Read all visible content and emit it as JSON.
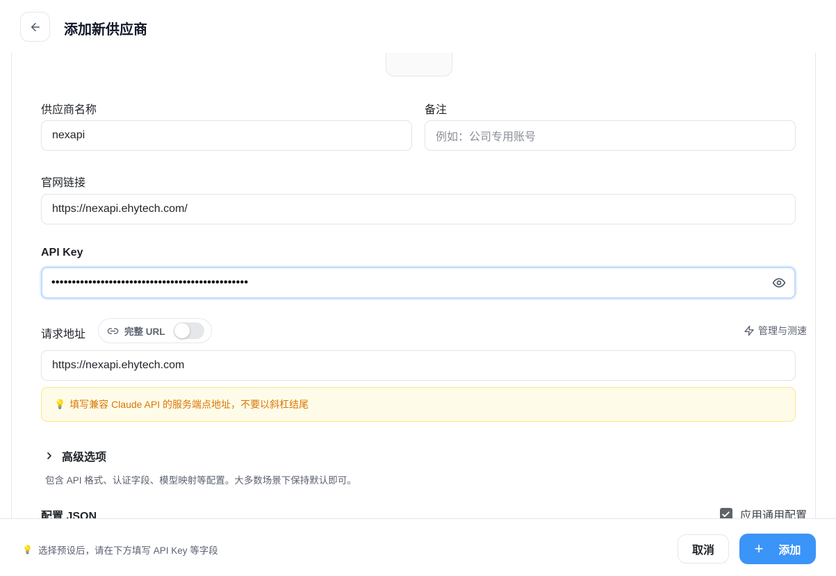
{
  "header": {
    "title": "添加新供应商"
  },
  "form": {
    "provider_name": {
      "label": "供应商名称",
      "value": "nexapi"
    },
    "note": {
      "label": "备注",
      "placeholder": "例如：公司专用账号"
    },
    "website": {
      "label": "官网链接",
      "value": "https://nexapi.ehytech.com/"
    },
    "api_key": {
      "label": "API Key",
      "masked_value": "••••••••••••••••••••••••••••••••••••••••••••••••"
    },
    "request_url": {
      "label": "请求地址",
      "full_url_toggle_label": "完整 URL",
      "full_url_enabled": false,
      "manage_label": "管理与测速",
      "value": "https://nexapi.ehytech.com",
      "hint": "填写兼容 Claude API 的服务端点地址，不要以斜杠结尾"
    },
    "advanced": {
      "title": "高级选项",
      "description": "包含 API 格式、认证字段、模型映射等配置。大多数场景下保持默认即可。"
    },
    "config_json": {
      "title": "配置 JSON",
      "apply_common_label": "应用通用配置",
      "apply_common_checked": true
    }
  },
  "footer": {
    "hint": "选择预设后，请在下方填写 API Key 等字段",
    "cancel_label": "取消",
    "add_label": "添加"
  },
  "colors": {
    "accent": "#3b94f7",
    "hint_text": "#d97706",
    "hint_bg": "#fefbe8",
    "focus_ring": "#bfdbfe"
  },
  "icons": {
    "back": "arrow-left-icon",
    "eye": "eye-icon",
    "link": "link-icon",
    "lightning": "zap-icon",
    "chevron": "chevron-right-icon",
    "bulb": "lightbulb-icon",
    "plus": "plus-icon",
    "check": "check-icon"
  }
}
